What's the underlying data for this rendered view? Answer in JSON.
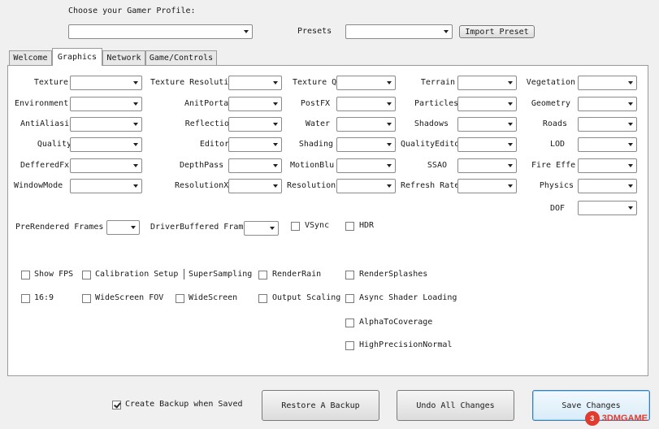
{
  "header": {
    "profile_label": "Choose your Gamer Profile:",
    "profile_value": "",
    "presets_label": "Presets",
    "presets_value": "",
    "import_label": "Import Preset"
  },
  "tabs": [
    {
      "label": "Welcome"
    },
    {
      "label": "Graphics"
    },
    {
      "label": "Network"
    },
    {
      "label": "Game/Controls"
    }
  ],
  "graphics": {
    "rows": [
      [
        {
          "label": "Texture"
        },
        {
          "label": "Texture Resolution"
        },
        {
          "label": "Texture Q"
        },
        {
          "label": "Terrain"
        },
        {
          "label": "Vegetation"
        }
      ],
      [
        {
          "label": "Environment"
        },
        {
          "label": "AnitPortal"
        },
        {
          "label": "PostFX"
        },
        {
          "label": "Particles"
        },
        {
          "label": "Geometry"
        }
      ],
      [
        {
          "label": "AntiAliasing"
        },
        {
          "label": "Reflection"
        },
        {
          "label": "Water"
        },
        {
          "label": "Shadows"
        },
        {
          "label": "Roads"
        }
      ],
      [
        {
          "label": "Quality"
        },
        {
          "label": "Editor"
        },
        {
          "label": "Shading"
        },
        {
          "label": "QualityEditor"
        },
        {
          "label": "LOD"
        }
      ],
      [
        {
          "label": "DefferedFx"
        },
        {
          "label": "DepthPass"
        },
        {
          "label": "MotionBlu"
        },
        {
          "label": "SSAO"
        },
        {
          "label": "Fire Effe"
        }
      ],
      [
        {
          "label": "WindowMode"
        },
        {
          "label": "ResolutionX"
        },
        {
          "label": "Resolution"
        },
        {
          "label": "Refresh Rate"
        },
        {
          "label": "Physics"
        }
      ]
    ],
    "dof_label": "DOF",
    "prerendered_label": "PreRendered Frames",
    "driverbuffered_label": "DriverBuffered Frames",
    "vsync_label": "VSync",
    "hdr_label": "HDR",
    "checkboxes": {
      "show_fps": "Show FPS",
      "calibration_setup": "Calibration Setup",
      "supersampling": "SuperSampling",
      "render_rain": "RenderRain",
      "render_splashes": "RenderSplashes",
      "ratio_16_9": "16:9",
      "widescreen_fov": "WideScreen FOV",
      "widescreen": "WideScreen",
      "output_scaling": "Output Scaling",
      "async_shader_loading": "Async Shader Loading",
      "alpha_to_coverage": "AlphaToCoverage",
      "high_precision_normal": "HighPrecisionNormal"
    }
  },
  "footer": {
    "create_backup_label": "Create Backup when Saved",
    "create_backup_checked": true,
    "restore_label": "Restore A Backup",
    "undo_label": "Undo All Changes",
    "save_label": "Save Changes"
  },
  "watermark": {
    "badge": "3",
    "text": "3DMGAME"
  }
}
